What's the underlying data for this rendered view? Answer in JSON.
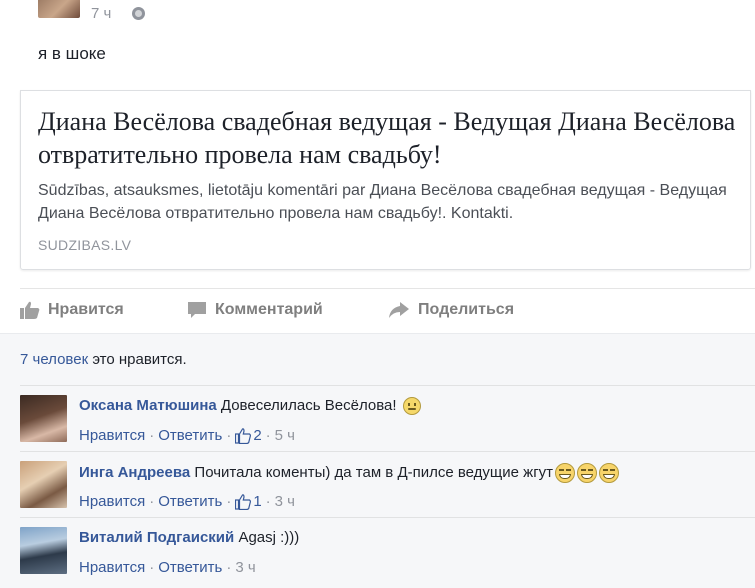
{
  "post": {
    "time": "7 ч",
    "text": "я в шоке"
  },
  "card": {
    "title": "Диана Весёлова свадебная ведущая - Ведущая Диана Весёлова отвратительно провела нам свадьбу!",
    "description": "Sūdzības, atsauksmes, lietotāju komentāri par Диана Весёлова свадебная ведущая - Ведущая Диана Весёлова отвратительно провела нам свадьбу!. Kontakti.",
    "domain": "SUDZIBAS.LV"
  },
  "actions": {
    "like": "Нравится",
    "comment": "Комментарий",
    "share": "Поделиться"
  },
  "likes": {
    "people": "7 человек",
    "suffix": "это нравится."
  },
  "comments": [
    {
      "name": "Оксана Матюшина",
      "text": "Довеселилась Весёлова!",
      "like": "Нравится",
      "reply": "Ответить",
      "like_count": "2",
      "time": "5 ч"
    },
    {
      "name": "Инга Андреева",
      "text": "Почитала коменты) да там в Д-пилсе ведущие жгут",
      "like": "Нравится",
      "reply": "Ответить",
      "like_count": "1",
      "time": "3 ч"
    },
    {
      "name": "Виталий Подгаиский",
      "text": "Agasj :)))",
      "like": "Нравится",
      "reply": "Ответить",
      "time": "3 ч"
    }
  ],
  "colors": {
    "link": "#365899",
    "meta": "#90949c",
    "action": "#7f7f7f"
  }
}
